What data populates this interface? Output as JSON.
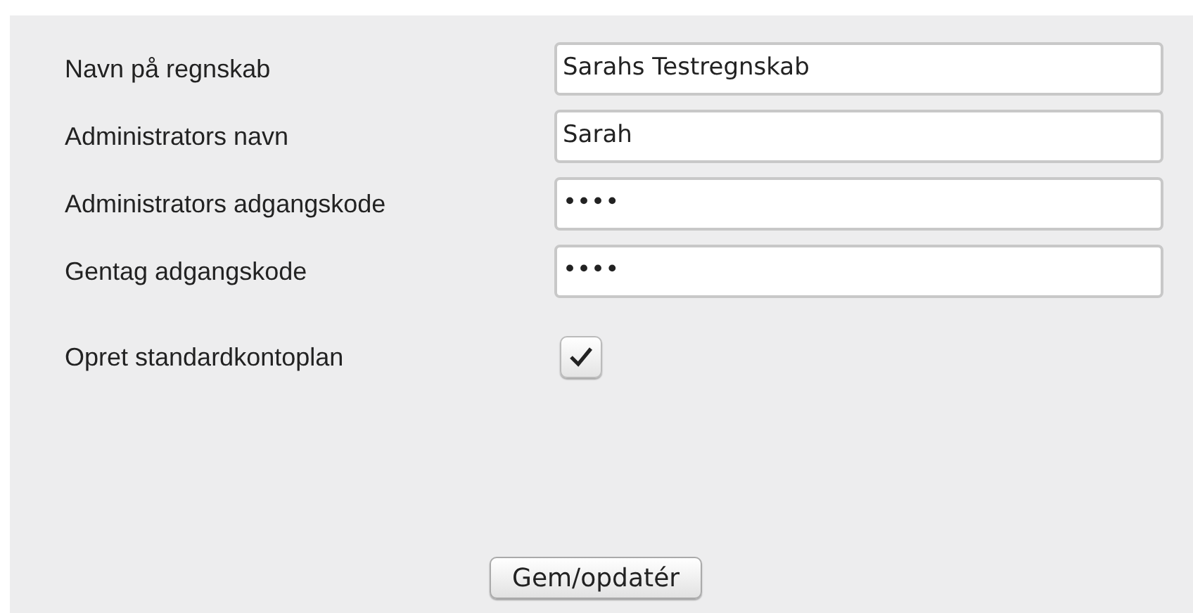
{
  "fields": [
    {
      "kind": "text",
      "label": "Navn på regnskab",
      "value": "Sarahs Testregnskab"
    },
    {
      "kind": "text",
      "label": "Administrators navn",
      "value": "Sarah"
    },
    {
      "kind": "password",
      "label": "Administrators adgangskode",
      "value": "••••"
    },
    {
      "kind": "password",
      "label": "Gentag adgangskode",
      "value": "••••"
    },
    {
      "kind": "checkbox",
      "label": "Opret standardkontoplan",
      "checked": true
    }
  ],
  "button": "Gem/opdatér"
}
